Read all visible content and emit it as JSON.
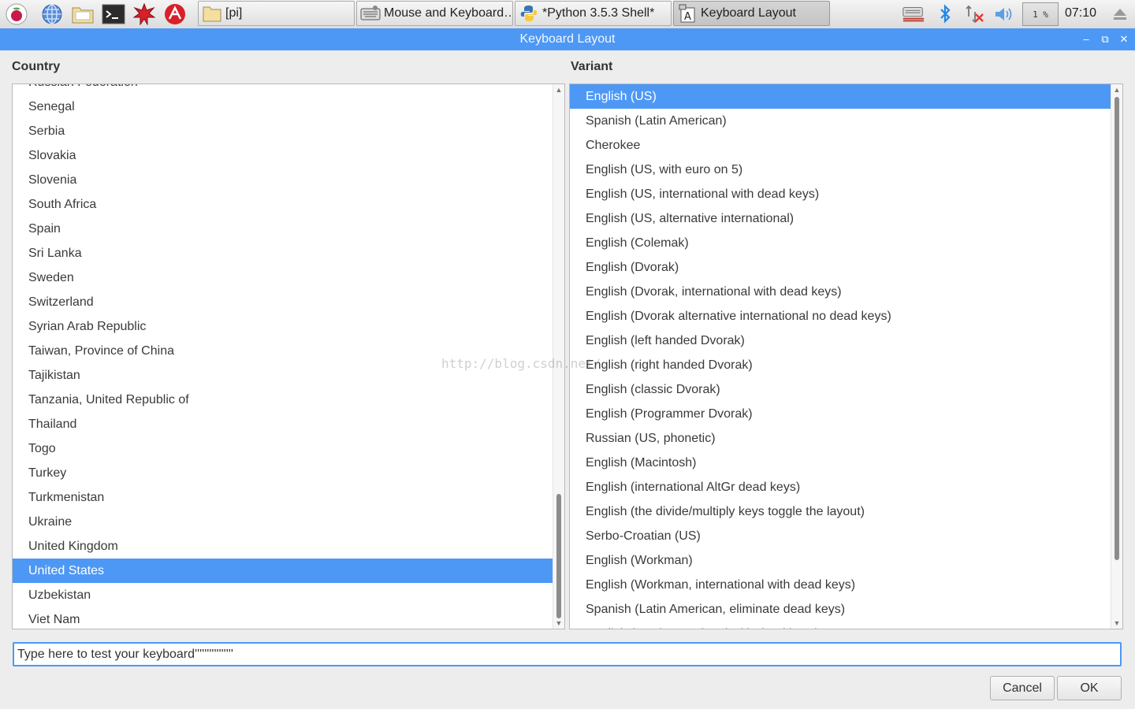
{
  "taskbar": {
    "launchers": [
      {
        "name": "raspberry-menu-icon"
      },
      {
        "name": "web-browser-icon"
      },
      {
        "name": "file-manager-icon"
      },
      {
        "name": "terminal-icon"
      },
      {
        "name": "math-icon"
      },
      {
        "name": "wolfram-icon"
      }
    ],
    "tasks": [
      {
        "label": "[pi]",
        "icon": "folder-icon"
      },
      {
        "label": "Mouse and Keyboard…",
        "icon": "keyboard-settings-icon"
      },
      {
        "label": "*Python 3.5.3 Shell*",
        "icon": "python-icon"
      },
      {
        "label": "Keyboard Layout",
        "icon": "keyboard-layout-icon"
      }
    ],
    "cpu": "1 %",
    "clock": "07:10"
  },
  "window": {
    "title": "Keyboard Layout",
    "minimize": "‒",
    "maximize": "⧉",
    "close": "✕"
  },
  "country": {
    "label": "Country",
    "partial_top": "Russian Federation",
    "items": [
      "Senegal",
      "Serbia",
      "Slovakia",
      "Slovenia",
      "South Africa",
      "Spain",
      "Sri Lanka",
      "Sweden",
      "Switzerland",
      "Syrian Arab Republic",
      "Taiwan, Province of China",
      "Tajikistan",
      "Tanzania, United Republic of",
      "Thailand",
      "Togo",
      "Turkey",
      "Turkmenistan",
      "Ukraine",
      "United Kingdom",
      "United States",
      "Uzbekistan",
      "Viet Nam"
    ],
    "selected": "United States"
  },
  "variant": {
    "label": "Variant",
    "items": [
      "English (US)",
      "Spanish (Latin American)",
      "Cherokee",
      "English (US, with euro on 5)",
      "English (US, international with dead keys)",
      "English (US, alternative international)",
      "English (Colemak)",
      "English (Dvorak)",
      "English (Dvorak, international with dead keys)",
      "English (Dvorak alternative international no dead keys)",
      "English (left handed Dvorak)",
      "English (right handed Dvorak)",
      "English (classic Dvorak)",
      "English (Programmer Dvorak)",
      "Russian (US, phonetic)",
      "English (Macintosh)",
      "English (international AltGr dead keys)",
      "English (the divide/multiply keys toggle the layout)",
      "Serbo-Croatian (US)",
      "English (Workman)",
      "English (Workman, international with dead keys)",
      "Spanish (Latin American, eliminate dead keys)"
    ],
    "partial_bottom": "English (US, international with dead keys)",
    "selected": "English (US)"
  },
  "test_field": {
    "value": "Type here to test your keyboard''''''''''''''''"
  },
  "buttons": {
    "cancel": "Cancel",
    "ok": "OK"
  },
  "watermark": "http://blog.csdn.net/..."
}
